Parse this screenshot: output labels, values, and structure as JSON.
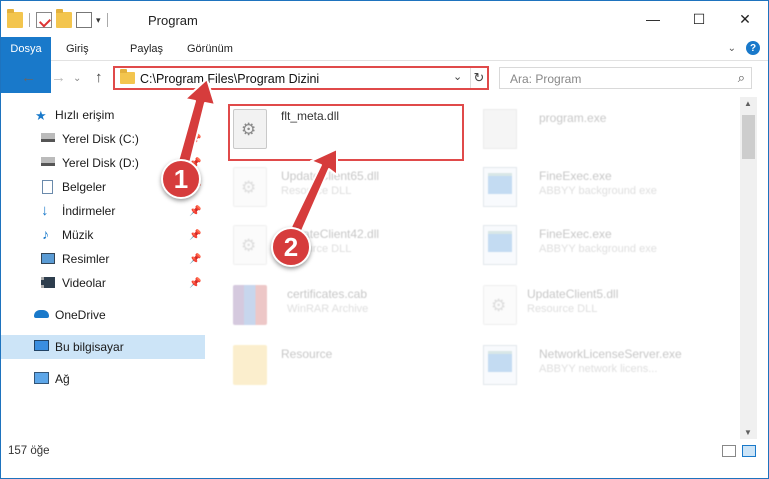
{
  "window": {
    "title": "Program",
    "min_glyph": "—",
    "max_glyph": "☐",
    "close_glyph": "✕"
  },
  "ribbon": {
    "tabs": [
      "Dosya",
      "Giriş",
      "Paylaş",
      "Görünüm"
    ]
  },
  "nav": {
    "address": "C:\\Program Files\\Program Dizini",
    "search_placeholder": "Ara: Program",
    "back": "←",
    "forward": "→",
    "up": "↑",
    "refresh": "↻",
    "dropdown": "⌄",
    "search_glyph": "⌕"
  },
  "sidebar": {
    "items": [
      {
        "label": "Hızlı erişim",
        "icon": "star-icon"
      },
      {
        "label": "Yerel Disk (C:)",
        "icon": "drive-icon",
        "pinned": true
      },
      {
        "label": "Yerel Disk (D:)",
        "icon": "drive-icon",
        "pinned": true
      },
      {
        "label": "Belgeler",
        "icon": "documents-icon",
        "pinned": true
      },
      {
        "label": "İndirmeler",
        "icon": "download-icon",
        "pinned": true
      },
      {
        "label": "Müzik",
        "icon": "music-icon",
        "pinned": true
      },
      {
        "label": "Resimler",
        "icon": "pictures-icon",
        "pinned": true
      },
      {
        "label": "Videolar",
        "icon": "videos-icon",
        "pinned": true
      },
      {
        "label": "OneDrive",
        "icon": "cloud-icon"
      },
      {
        "label": "Bu bilgisayar",
        "icon": "computer-icon",
        "selected": true
      },
      {
        "label": "Ağ",
        "icon": "network-icon"
      }
    ]
  },
  "files": [
    {
      "name": "flt_meta.dll",
      "desc": "",
      "icon": "dll-icon"
    },
    {
      "name": "program.exe",
      "desc": "",
      "icon": "program-icon"
    },
    {
      "name": "UpdateClient65.dll",
      "desc": "Resource DLL",
      "icon": "dll-icon"
    },
    {
      "name": "FineExec.exe",
      "desc": "ABBYY background exe",
      "icon": "exe-icon"
    },
    {
      "name": "UpdateClient42.dll",
      "desc": "Resource DLL",
      "icon": "dll-icon"
    },
    {
      "name": "FineExec.exe",
      "desc": "ABBYY background exe",
      "icon": "exe-icon"
    },
    {
      "name": "certificates.cab",
      "desc": "WinRAR Archive",
      "icon": "archive-icon"
    },
    {
      "name": "UpdateClient5.dll",
      "desc": "Resource DLL",
      "icon": "dll-icon"
    },
    {
      "name": "Resource",
      "desc": "",
      "icon": "folder-icon"
    },
    {
      "name": "NetworkLicenseServer.exe",
      "desc": "ABBYY network licens...",
      "icon": "exe-icon"
    }
  ],
  "status": {
    "count": "157 öğe"
  },
  "annotations": {
    "badge1": "1",
    "badge2": "2"
  },
  "colors": {
    "accent": "#1979ca",
    "highlight": "#e04a4a",
    "selected": "#cce4f7"
  }
}
